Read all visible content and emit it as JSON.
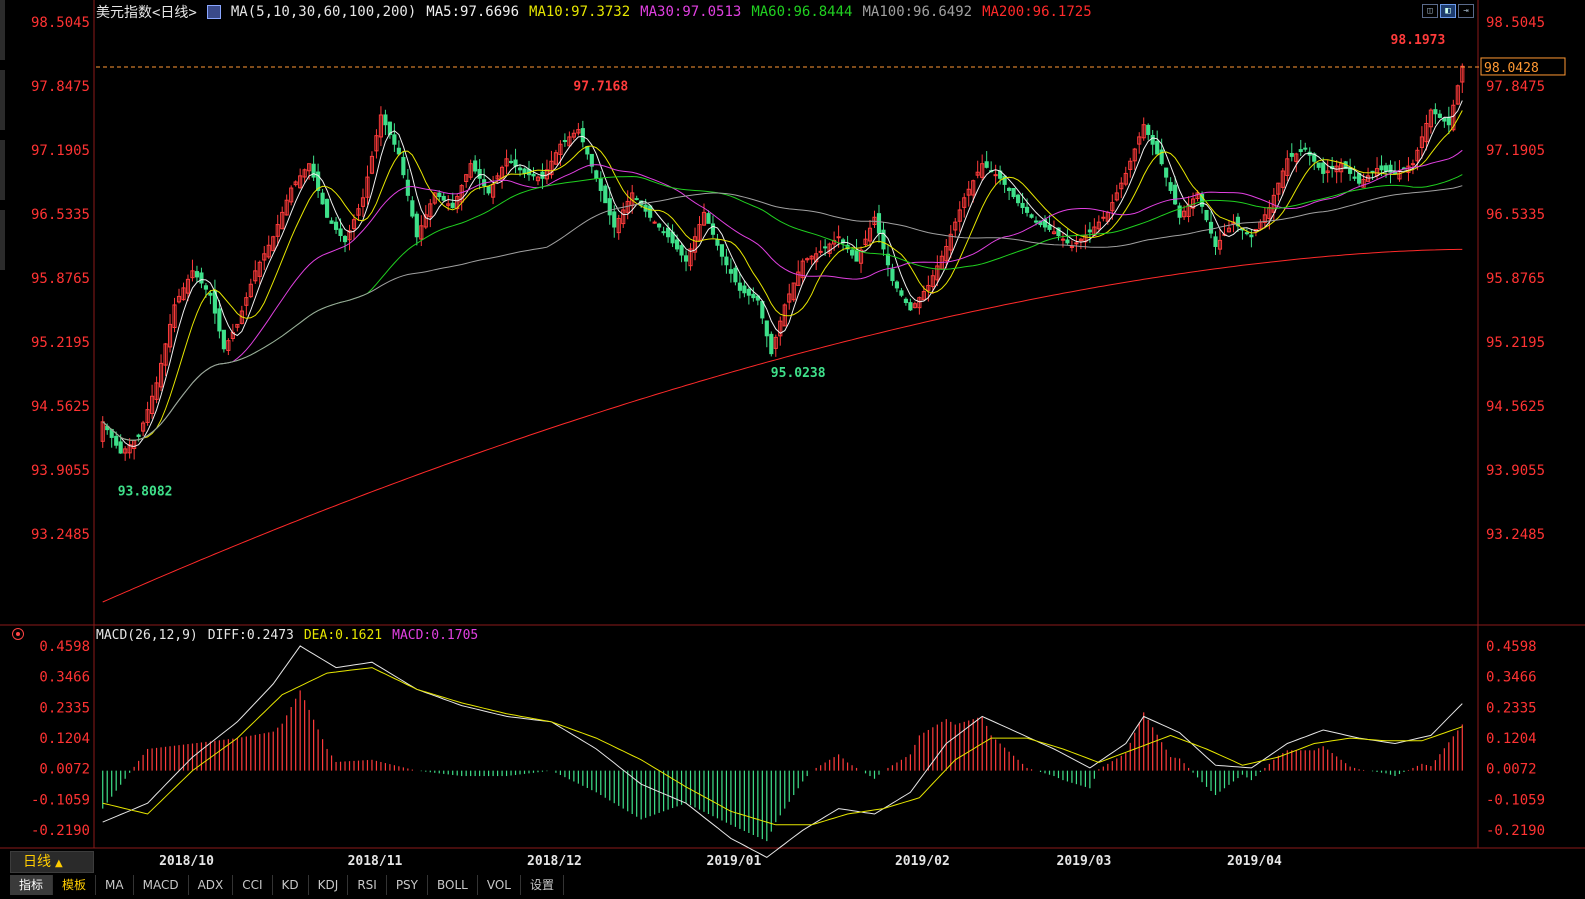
{
  "header": {
    "title": "美元指数<日线>",
    "ma_params": "MA(5,10,30,60,100,200)",
    "ma_items": [
      {
        "label": "MA5:97.6696",
        "color": "#f0f0f0"
      },
      {
        "label": "MA10:97.3732",
        "color": "#e6e600"
      },
      {
        "label": "MA30:97.0513",
        "color": "#e040e0"
      },
      {
        "label": "MA60:96.8444",
        "color": "#20d020"
      },
      {
        "label": "MA100:96.6492",
        "color": "#a0a0a0"
      },
      {
        "label": "MA200:96.1725",
        "color": "#ff2a2a"
      }
    ]
  },
  "toolbar": {
    "icons": [
      "panel-icon",
      "layout-icon",
      "expand-icon"
    ]
  },
  "price_axis": {
    "labels": [
      "98.5045",
      "97.8475",
      "97.1905",
      "96.5335",
      "95.8765",
      "95.2195",
      "94.5625",
      "93.9055",
      "93.2485"
    ],
    "current_price": "98.0428"
  },
  "annotations": {
    "high_overall": "98.1973",
    "high_mid": "97.7168",
    "low_mid": "95.0238",
    "low_start": "93.8082"
  },
  "macd_header": {
    "params": "MACD(26,12,9)",
    "items": [
      {
        "label": "DIFF:0.2473",
        "color": "#e6e6e6"
      },
      {
        "label": "DEA:0.1621",
        "color": "#e6e600"
      },
      {
        "label": "MACD:0.1705",
        "color": "#e040e0"
      }
    ]
  },
  "macd_axis": {
    "labels": [
      "0.4598",
      "0.3466",
      "0.2335",
      "0.1204",
      "0.0072",
      "-0.1059",
      "-0.2190"
    ]
  },
  "x_axis": {
    "labels": [
      "2018/10",
      "2018/11",
      "2018/12",
      "2019/01",
      "2019/02",
      "2019/03",
      "2019/04"
    ]
  },
  "period_button": {
    "label": "日线",
    "arrow": "▲"
  },
  "bottom_tabs": [
    "指标",
    "模板",
    "MA",
    "MACD",
    "ADX",
    "CCI",
    "KD",
    "KDJ",
    "RSI",
    "PSY",
    "BOLL",
    "VOL",
    "设置"
  ],
  "colors": {
    "up": "#ff3b3b",
    "down": "#3fe08a",
    "axis": "#8b1a1a",
    "dashed": "#ff9933"
  },
  "chart_data": {
    "type": "candlestick",
    "title": "美元指数<日线>",
    "x_labels": [
      "2018/10",
      "2018/11",
      "2018/12",
      "2019/01",
      "2019/02",
      "2019/03",
      "2019/04"
    ],
    "price_range": [
      93.2485,
      98.5045
    ],
    "macd_range": [
      -0.219,
      0.4598
    ],
    "last_close": 98.0428,
    "annotated_high": 98.1973,
    "annotated_low": 93.8082,
    "series": [
      {
        "name": "MA5",
        "last": 97.6696
      },
      {
        "name": "MA10",
        "last": 97.3732
      },
      {
        "name": "MA30",
        "last": 97.0513
      },
      {
        "name": "MA60",
        "last": 96.8444
      },
      {
        "name": "MA100",
        "last": 96.6492
      },
      {
        "name": "MA200",
        "last": 96.1725
      }
    ],
    "close_path": [
      [
        0,
        94.4
      ],
      [
        4,
        94.08
      ],
      [
        8,
        94.25
      ],
      [
        12,
        94.8
      ],
      [
        16,
        95.6
      ],
      [
        20,
        95.95
      ],
      [
        24,
        95.7
      ],
      [
        27,
        95.15
      ],
      [
        30,
        95.4
      ],
      [
        34,
        95.95
      ],
      [
        38,
        96.3
      ],
      [
        42,
        96.8
      ],
      [
        46,
        97.05
      ],
      [
        50,
        96.5
      ],
      [
        54,
        96.25
      ],
      [
        58,
        96.7
      ],
      [
        62,
        97.55
      ],
      [
        66,
        97.15
      ],
      [
        70,
        96.3
      ],
      [
        74,
        96.75
      ],
      [
        78,
        96.6
      ],
      [
        82,
        97.05
      ],
      [
        86,
        96.75
      ],
      [
        90,
        97.1
      ],
      [
        94,
        96.95
      ],
      [
        98,
        96.9
      ],
      [
        102,
        97.25
      ],
      [
        106,
        97.4
      ],
      [
        110,
        96.9
      ],
      [
        114,
        96.4
      ],
      [
        118,
        96.75
      ],
      [
        122,
        96.5
      ],
      [
        126,
        96.3
      ],
      [
        130,
        96.05
      ],
      [
        134,
        96.55
      ],
      [
        138,
        96.1
      ],
      [
        142,
        95.75
      ],
      [
        146,
        95.65
      ],
      [
        149,
        95.1
      ],
      [
        152,
        95.6
      ],
      [
        156,
        96.05
      ],
      [
        160,
        96.15
      ],
      [
        164,
        96.3
      ],
      [
        168,
        96.05
      ],
      [
        172,
        96.5
      ],
      [
        176,
        95.85
      ],
      [
        180,
        95.55
      ],
      [
        184,
        95.8
      ],
      [
        188,
        96.2
      ],
      [
        192,
        96.7
      ],
      [
        196,
        97.05
      ],
      [
        200,
        96.9
      ],
      [
        204,
        96.65
      ],
      [
        208,
        96.45
      ],
      [
        212,
        96.35
      ],
      [
        216,
        96.2
      ],
      [
        220,
        96.35
      ],
      [
        224,
        96.55
      ],
      [
        228,
        96.95
      ],
      [
        232,
        97.45
      ],
      [
        236,
        97.05
      ],
      [
        240,
        96.5
      ],
      [
        244,
        96.75
      ],
      [
        248,
        96.2
      ],
      [
        252,
        96.45
      ],
      [
        256,
        96.3
      ],
      [
        260,
        96.6
      ],
      [
        264,
        97.1
      ],
      [
        268,
        97.2
      ],
      [
        272,
        96.95
      ],
      [
        276,
        97.05
      ],
      [
        280,
        96.85
      ],
      [
        284,
        97.0
      ],
      [
        288,
        96.95
      ],
      [
        292,
        97.05
      ],
      [
        296,
        97.6
      ],
      [
        300,
        97.45
      ],
      [
        303,
        98.05
      ]
    ],
    "macd_diff_path": [
      [
        0,
        -0.19
      ],
      [
        10,
        -0.12
      ],
      [
        20,
        0.05
      ],
      [
        30,
        0.18
      ],
      [
        38,
        0.32
      ],
      [
        44,
        0.46
      ],
      [
        52,
        0.38
      ],
      [
        60,
        0.4
      ],
      [
        70,
        0.3
      ],
      [
        80,
        0.24
      ],
      [
        90,
        0.2
      ],
      [
        100,
        0.18
      ],
      [
        110,
        0.08
      ],
      [
        120,
        -0.05
      ],
      [
        130,
        -0.12
      ],
      [
        140,
        -0.25
      ],
      [
        148,
        -0.32
      ],
      [
        156,
        -0.22
      ],
      [
        164,
        -0.14
      ],
      [
        172,
        -0.16
      ],
      [
        180,
        -0.08
      ],
      [
        188,
        0.1
      ],
      [
        196,
        0.2
      ],
      [
        204,
        0.14
      ],
      [
        212,
        0.08
      ],
      [
        220,
        0.01
      ],
      [
        228,
        0.1
      ],
      [
        232,
        0.2
      ],
      [
        240,
        0.14
      ],
      [
        248,
        0.02
      ],
      [
        256,
        0.01
      ],
      [
        264,
        0.1
      ],
      [
        272,
        0.15
      ],
      [
        280,
        0.12
      ],
      [
        288,
        0.1
      ],
      [
        296,
        0.13
      ],
      [
        303,
        0.2473
      ]
    ],
    "macd_dea_path": [
      [
        0,
        -0.12
      ],
      [
        10,
        -0.16
      ],
      [
        20,
        0.0
      ],
      [
        30,
        0.12
      ],
      [
        40,
        0.28
      ],
      [
        50,
        0.36
      ],
      [
        60,
        0.38
      ],
      [
        70,
        0.3
      ],
      [
        80,
        0.25
      ],
      [
        90,
        0.21
      ],
      [
        100,
        0.18
      ],
      [
        110,
        0.12
      ],
      [
        120,
        0.04
      ],
      [
        130,
        -0.06
      ],
      [
        140,
        -0.15
      ],
      [
        150,
        -0.2
      ],
      [
        158,
        -0.2
      ],
      [
        166,
        -0.16
      ],
      [
        174,
        -0.14
      ],
      [
        182,
        -0.1
      ],
      [
        190,
        0.04
      ],
      [
        198,
        0.12
      ],
      [
        206,
        0.12
      ],
      [
        214,
        0.08
      ],
      [
        222,
        0.03
      ],
      [
        230,
        0.08
      ],
      [
        238,
        0.13
      ],
      [
        246,
        0.08
      ],
      [
        254,
        0.02
      ],
      [
        262,
        0.05
      ],
      [
        270,
        0.1
      ],
      [
        278,
        0.12
      ],
      [
        286,
        0.11
      ],
      [
        294,
        0.11
      ],
      [
        303,
        0.1621
      ]
    ]
  }
}
